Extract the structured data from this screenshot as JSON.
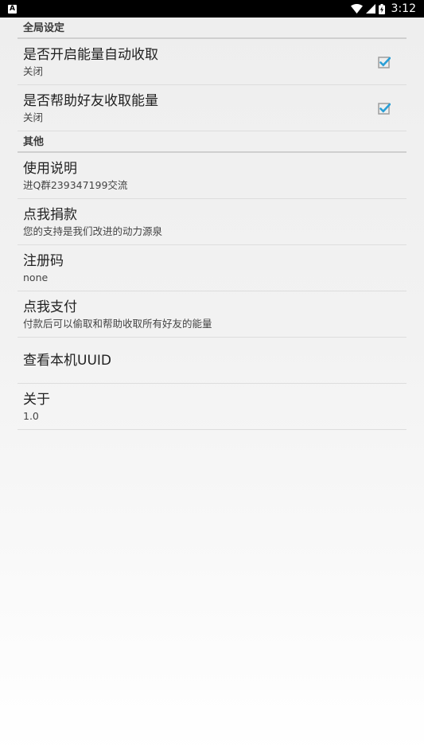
{
  "status_bar": {
    "notification_icon": "A",
    "time": "3:12",
    "icons": [
      "wifi-icon",
      "signal-icon",
      "battery-charging-icon"
    ]
  },
  "colors": {
    "accent": "#2a9fd6",
    "divider": "#dddddd",
    "category_divider": "#cfcfcf"
  },
  "sections": [
    {
      "title": "全局设定",
      "items": [
        {
          "title": "是否开启能量自动收取",
          "summary": "关闭",
          "checked": true
        },
        {
          "title": "是否帮助好友收取能量",
          "summary": "关闭",
          "checked": true
        }
      ]
    },
    {
      "title": "其他",
      "items": [
        {
          "title": "使用说明",
          "summary": "进Q群239347199交流"
        },
        {
          "title": "点我捐款",
          "summary": "您的支持是我们改进的动力源泉"
        },
        {
          "title": "注册码",
          "summary": "none"
        },
        {
          "title": "点我支付",
          "summary": "付款后可以偷取和帮助收取所有好友的能量"
        },
        {
          "title": "查看本机UUID"
        },
        {
          "title": "关于",
          "summary": "1.0"
        }
      ]
    }
  ]
}
